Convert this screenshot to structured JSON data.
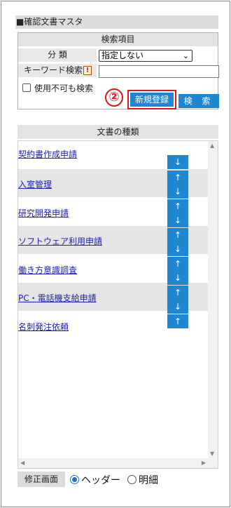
{
  "panel": {
    "title": "■確認文書マスタ"
  },
  "search": {
    "header": "検索項目",
    "category_label": "分 類",
    "category_value": "指定しない",
    "keyword_label": "キーワード検索",
    "keyword_warning_icon": "!",
    "keyword_value": "",
    "unusable_label": "使用不可も検索",
    "unusable_checked": false,
    "step_marker": "②",
    "new_button": "新規登録",
    "search_button": "検 索"
  },
  "list": {
    "header": "文書の種類",
    "items": [
      {
        "label": "契約書作成申請",
        "up": false,
        "down": true
      },
      {
        "label": "入室管理",
        "up": true,
        "down": true
      },
      {
        "label": "研究開発申請",
        "up": true,
        "down": true
      },
      {
        "label": "ソフトウェア利用申請",
        "up": true,
        "down": true
      },
      {
        "label": "働き方意識調査",
        "up": true,
        "down": true
      },
      {
        "label": "PC・電話機支給申請",
        "up": true,
        "down": true
      },
      {
        "label": "名刺発注依頼",
        "up": true,
        "down": false
      }
    ],
    "arrow_up": "↑",
    "arrow_down": "↓"
  },
  "footer": {
    "edit_label": "修正画面",
    "radio_header": "ヘッダー",
    "radio_detail": "明細",
    "selected": "header"
  },
  "colors": {
    "accent": "#1f86d1",
    "highlight": "#e0161b"
  }
}
